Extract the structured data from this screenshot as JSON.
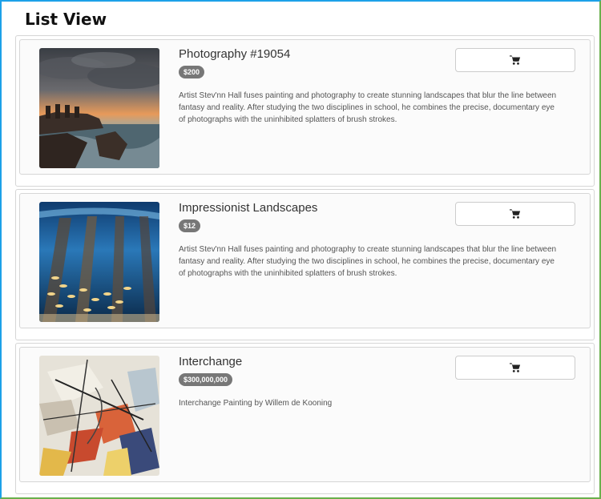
{
  "page": {
    "title": "List View"
  },
  "products": [
    {
      "title": "Photography #19054",
      "price": "$200",
      "description": "Artist Stev'nn Hall fuses painting and photography to create stunning landscapes that blur the line between fantasy and reality. After studying the two disciplines in school, he combines the precise, documentary eye of photographs with the uninhibited splatters of brush strokes.",
      "cart_icon": "shopping-cart-icon"
    },
    {
      "title": "Impressionist Landscapes",
      "price": "$12",
      "description": "Artist Stev'nn Hall fuses painting and photography to create stunning landscapes that blur the line between fantasy and reality. After studying the two disciplines in school, he combines the precise, documentary eye of photographs with the uninhibited splatters of brush strokes.",
      "cart_icon": "shopping-cart-icon"
    },
    {
      "title": "Interchange",
      "price": "$300,000,000",
      "description": "Interchange Painting by Willem de Kooning",
      "cart_icon": "shopping-cart-icon"
    }
  ],
  "colors": {
    "frame_top_left": "#1da1e8",
    "frame_bottom_right": "#6ab04c",
    "badge": "#777777"
  }
}
